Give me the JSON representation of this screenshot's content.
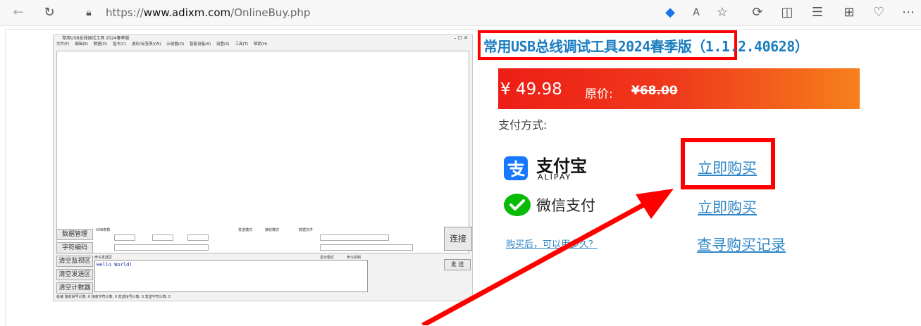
{
  "browser": {
    "url_prefix": "https://",
    "url_domain": "www.adixm.com",
    "url_path": "/OnlineBuy.php"
  },
  "software": {
    "window_title": "常用USB总线调试工具 2024春季版",
    "menu": [
      "文件(F)",
      "编辑(E)",
      "数据(D)",
      "指令(C)",
      "波形(标签表)(W)",
      "示波器(O)",
      "智能设备(A)",
      "设置(S)",
      "工具(T)",
      "帮助(H)"
    ],
    "side_buttons": [
      "数据管理",
      "字符编码",
      "清空监视区",
      "清空发送区",
      "清空计数器"
    ],
    "send_text": "Hello World!",
    "connect_label": "连接",
    "send_label": "发 送",
    "usb_params_label": "USB参数",
    "recv_mode_label": "接收模式",
    "send_mode_label": "发送模式",
    "data_file_label": "数据文件",
    "display_mode_label": "显示模式",
    "send_control_label": "命令控制",
    "send_area_label": "命令发送区",
    "status_text": "就绪    接收帧号计数: 0    接收字符计数: 0    发送帧号计数: 0    发送字符计数: 0"
  },
  "product": {
    "title": "常用USB总线调试工具2024春季版（1.1.2.40628）",
    "price": "¥ 49.98",
    "original_label": "原价:",
    "original_price": "¥68.00",
    "payment_label": "支付方式:"
  },
  "payments": {
    "alipay_name": "支付宝",
    "alipay_sub": "ALIPAY",
    "alipay_buy": "立即购买",
    "wechat_name": "微信支付",
    "wechat_buy": "立即购买"
  },
  "links": {
    "faq": "购买后，可以用多久？",
    "records": "查寻购买记录"
  },
  "colors": {
    "highlight": "#ff0000",
    "link": "#2e86c8",
    "title": "#1a7dc1",
    "alipay": "#1677ff",
    "wechat": "#09bb07"
  }
}
